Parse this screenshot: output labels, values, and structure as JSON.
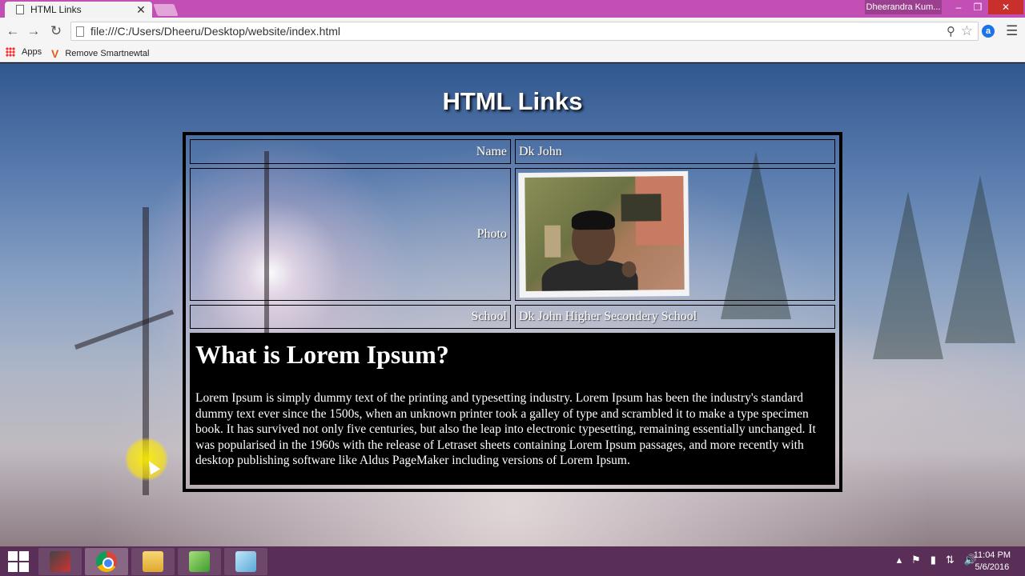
{
  "browser": {
    "tab_title": "HTML Links",
    "tab_close": "✕",
    "user_name": "Dheerandra Kum...",
    "window_minimize": "–",
    "window_restore": "❐",
    "window_close": "✕",
    "url": "file:///C:/Users/Dheeru/Desktop/website/index.html",
    "bookmarks": [
      {
        "label": "Apps"
      },
      {
        "label": "Remove Smartnewtal"
      }
    ]
  },
  "page": {
    "heading": "HTML Links",
    "rows": [
      {
        "label": "Name",
        "value": "Dk John"
      },
      {
        "label": "Photo"
      },
      {
        "label": "School",
        "value": "Dk John Higher Secondery School"
      }
    ],
    "article": {
      "title": "What is Lorem Ipsum?",
      "text": "Lorem Ipsum is simply dummy text of the printing and typesetting industry. Lorem Ipsum has been the industry's standard dummy text ever since the 1500s, when an unknown printer took a galley of type and scrambled it to make a type specimen book. It has survived not only five centuries, but also the leap into electronic typesetting, remaining essentially unchanged. It was popularised in the 1960s with the release of Letraset sheets containing Lorem Ipsum passages, and more recently with desktop publishing software like Aldus PageMaker including versions of Lorem Ipsum."
    }
  },
  "taskbar": {
    "clock_time": "11:04 PM",
    "clock_date": "5/6/2016",
    "apps": [
      "media-app",
      "chrome",
      "file-explorer",
      "notepad-plus",
      "notepad"
    ]
  },
  "colors": {
    "titlebar": "#c24fb3",
    "taskbar": "#5a2f57"
  }
}
